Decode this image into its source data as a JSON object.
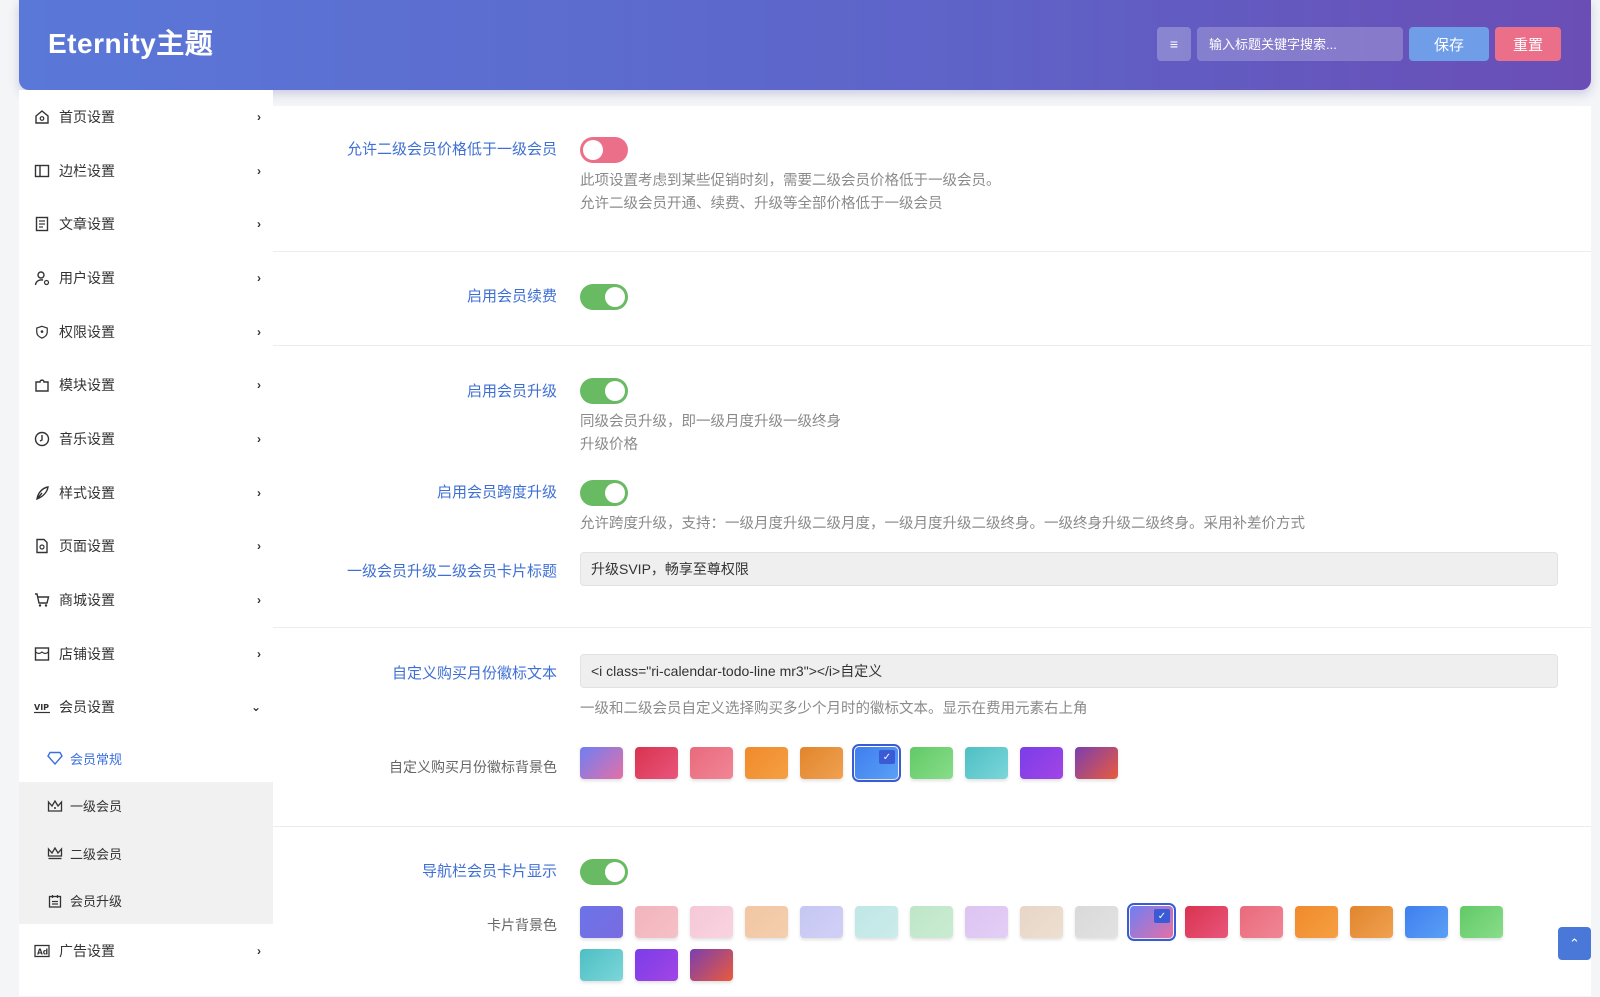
{
  "header": {
    "brand": "Eternity主题",
    "search_placeholder": "输入标题关键字搜索...",
    "save_label": "保存",
    "reset_label": "重置"
  },
  "sidebar": {
    "items": [
      {
        "label": "首页设置",
        "icon": "home-icon"
      },
      {
        "label": "边栏设置",
        "icon": "sidebar-icon"
      },
      {
        "label": "文章设置",
        "icon": "article-icon"
      },
      {
        "label": "用户设置",
        "icon": "user-icon"
      },
      {
        "label": "权限设置",
        "icon": "shield-icon"
      },
      {
        "label": "模块设置",
        "icon": "puzzle-icon"
      },
      {
        "label": "音乐设置",
        "icon": "music-icon"
      },
      {
        "label": "样式设置",
        "icon": "brush-icon"
      },
      {
        "label": "页面设置",
        "icon": "page-icon"
      },
      {
        "label": "商城设置",
        "icon": "cart-icon"
      },
      {
        "label": "店铺设置",
        "icon": "store-icon"
      },
      {
        "label": "会员设置",
        "icon": "vip-icon"
      }
    ],
    "sub_items": [
      {
        "label": "会员常规",
        "icon": "diamond-icon"
      },
      {
        "label": "一级会员",
        "icon": "crown-icon"
      },
      {
        "label": "二级会员",
        "icon": "crown2-icon"
      },
      {
        "label": "会员升级",
        "icon": "calendar-icon"
      }
    ],
    "after_items": [
      {
        "label": "广告设置",
        "icon": "ad-icon"
      }
    ]
  },
  "settings": {
    "allow_lower_price": {
      "label": "允许二级会员价格低于一级会员",
      "enabled": false,
      "desc1": "此项设置考虑到某些促销时刻，需要二级会员价格低于一级会员。",
      "desc2": "允许二级会员开通、续费、升级等全部价格低于一级会员"
    },
    "renew": {
      "label": "启用会员续费",
      "enabled": true
    },
    "upgrade": {
      "label": "启用会员升级",
      "enabled": true,
      "desc1": "同级会员升级，即一级月度升级一级终身",
      "desc2": "升级价格"
    },
    "cross_upgrade": {
      "label": "启用会员跨度升级",
      "enabled": true,
      "desc": "允许跨度升级，支持：一级月度升级二级月度，一级月度升级二级终身。一级终身升级二级终身。采用补差价方式"
    },
    "card_title": {
      "label": "一级会员升级二级会员卡片标题",
      "value": "升级SVIP，畅享至尊权限"
    },
    "badge_text": {
      "label": "自定义购买月份徽标文本",
      "value": "<i class=\"ri-calendar-todo-line mr3\"></i>自定义",
      "desc": "一级和二级会员自定义选择购买多少个月时的徽标文本。显示在费用元素右上角"
    },
    "badge_bg": {
      "label": "自定义购买月份徽标背景色"
    },
    "nav_card": {
      "label": "导航栏会员卡片显示",
      "enabled": true
    },
    "card_bg": {
      "label": "卡片背景色"
    }
  },
  "colors": {
    "badge_swatches": [
      "linear-gradient(135deg,#6e7ff3,#e56fa6)",
      "linear-gradient(135deg,#d9334f,#e9557c)",
      "linear-gradient(135deg,#e96a7c,#f08695)",
      "linear-gradient(135deg,#f08a2b,#f5a043)",
      "linear-gradient(135deg,#e1852d,#f0a150)",
      "linear-gradient(135deg,#3f7ef0,#5aa0f5)",
      "linear-gradient(135deg,#62c966,#88dd8a)",
      "linear-gradient(135deg,#4ebfc4,#7bd6d9)",
      "linear-gradient(135deg,#7a3de8,#a245e6)",
      "linear-gradient(135deg,#7a3fb0,#ea5a3c)"
    ],
    "badge_selected": 5,
    "card_swatches": [
      "linear-gradient(135deg,#6a74e8,#7a6be0)",
      "linear-gradient(135deg,#f2b4bc,#f5c1c6)",
      "linear-gradient(135deg,#f5c8d8,#f9d3e0)",
      "linear-gradient(135deg,#f1c6a3,#f4cfae)",
      "linear-gradient(135deg,#c6c6f4,#d0d0f6)",
      "linear-gradient(135deg,#bfe7e5,#cbeceb)",
      "linear-gradient(135deg,#bfe6c8,#c9ecd1)",
      "linear-gradient(135deg,#dcc4f2,#e3cff5)",
      "linear-gradient(135deg,#e8d6c6,#eddfd1)",
      "linear-gradient(135deg,#d9d9d9,#e2e2e2)",
      "linear-gradient(135deg,#6e7ff3,#e56fa6)",
      "linear-gradient(135deg,#d9334f,#e9557c)",
      "linear-gradient(135deg,#e96a7c,#f08695)",
      "linear-gradient(135deg,#f08a2b,#f5a043)",
      "linear-gradient(135deg,#e1852d,#f0a150)",
      "linear-gradient(135deg,#3f7ef0,#5aa0f5)",
      "linear-gradient(135deg,#62c966,#88dd8a)",
      "linear-gradient(135deg,#4ebfc4,#7bd6d9)",
      "linear-gradient(135deg,#7a3de8,#a245e6)",
      "linear-gradient(135deg,#7a3fb0,#ea5a3c)"
    ],
    "card_selected": 10
  },
  "icons": {
    "menu_toggle": "≡",
    "arrow_right": "›",
    "arrow_down": "⌄",
    "check": "✓",
    "scroll_top": "⌃"
  }
}
